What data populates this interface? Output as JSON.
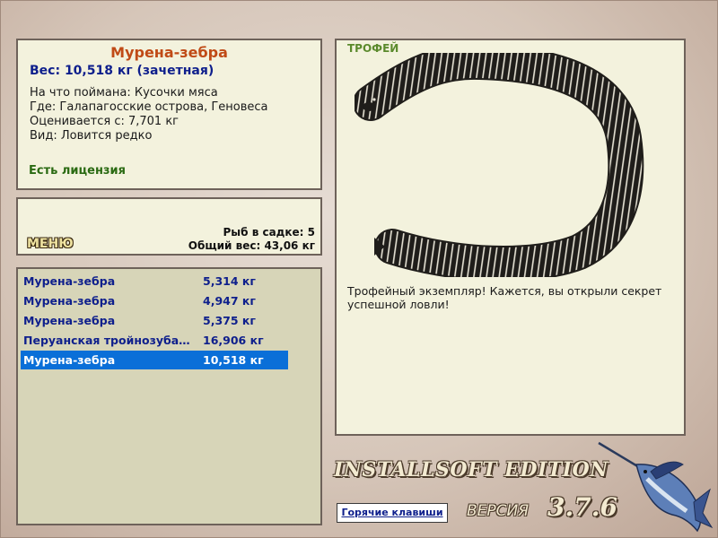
{
  "info": {
    "title": "Мурена-зебра",
    "weight": "Вес: 10,518 кг (зачетная)",
    "bait": "На что поймана: Кусочки мяса",
    "location": "Где: Галапагосские острова, Геновеса",
    "valued": "Оценивается с: 7,701 кг",
    "kind": "Вид: Ловится редко",
    "license": "Есть лицензия"
  },
  "keepnet": {
    "menu_label": "МЕНЮ",
    "count": "Рыб в садке: 5",
    "total": "Общий вес: 43,06 кг"
  },
  "catch_list": [
    {
      "name": "Мурена-зебра",
      "weight": "5,314 кг",
      "selected": false
    },
    {
      "name": "Мурена-зебра",
      "weight": "4,947 кг",
      "selected": false
    },
    {
      "name": "Мурена-зебра",
      "weight": "5,375 кг",
      "selected": false
    },
    {
      "name": "Перуанская тройнозубая рыба",
      "weight": "16,906 кг",
      "selected": false
    },
    {
      "name": "Мурена-зебра",
      "weight": "10,518 кг",
      "selected": true
    }
  ],
  "trophy": {
    "tag": "ТРОФЕЙ",
    "image_icon": "zebra-moray-eel-image",
    "description": "Трофейный экземпляр! Кажется, вы открыли секрет успешной ловли!"
  },
  "footer": {
    "edition": "INSTALLSOFT EDITION",
    "hotkeys": "Горячие клавиши",
    "version_label": "ВЕРСИЯ",
    "version_number": "3.7.6",
    "logo_icon": "marlin-logo"
  },
  "colors": {
    "panel_bg": "#f3f2dd",
    "list_bg": "#d7d5b8",
    "selection": "#0a6fd8",
    "fish_name": "#c04a16",
    "text_blue": "#0e1f8c",
    "license_green": "#2a6a12"
  }
}
